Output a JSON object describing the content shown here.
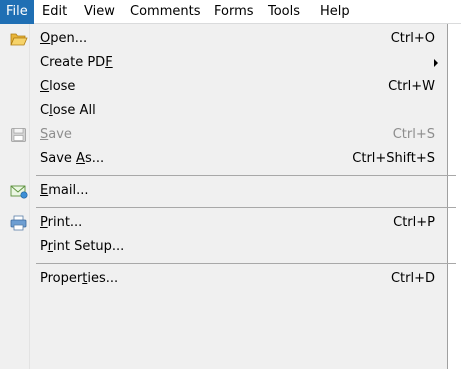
{
  "menubar": {
    "items": [
      {
        "label": "File",
        "active": true
      },
      {
        "label": "Edit"
      },
      {
        "label": "View"
      },
      {
        "label": "Comments"
      },
      {
        "label": "Forms"
      },
      {
        "label": "Tools"
      },
      {
        "label": "Help"
      }
    ]
  },
  "file_menu": {
    "items": [
      {
        "pre": "",
        "mn": "O",
        "post": "pen...",
        "shortcut": "Ctrl+O",
        "icon": "folder-open-icon"
      },
      {
        "pre": "Create PD",
        "mn": "F",
        "post": "",
        "shortcut": "",
        "submenu": true
      },
      {
        "pre": "",
        "mn": "C",
        "post": "lose",
        "shortcut": "Ctrl+W"
      },
      {
        "pre": "C",
        "mn": "l",
        "post": "ose All",
        "shortcut": ""
      },
      {
        "pre": "",
        "mn": "S",
        "post": "ave",
        "shortcut": "Ctrl+S",
        "disabled": true,
        "icon": "save-icon"
      },
      {
        "pre": "Save ",
        "mn": "A",
        "post": "s...",
        "shortcut": "Ctrl+Shift+S"
      },
      {
        "pre": "",
        "mn": "E",
        "post": "mail...",
        "shortcut": "",
        "icon": "email-icon"
      },
      {
        "pre": "",
        "mn": "P",
        "post": "rint...",
        "shortcut": "Ctrl+P",
        "icon": "printer-icon"
      },
      {
        "pre": "P",
        "mn": "r",
        "post": "int Setup...",
        "shortcut": ""
      },
      {
        "pre": "Proper",
        "mn": "t",
        "post": "ies...",
        "shortcut": "Ctrl+D"
      }
    ]
  },
  "colors": {
    "menubar_active_bg": "#1f6fb4",
    "menu_bg": "#f0f0f0",
    "disabled_text": "#8d8d8d"
  }
}
